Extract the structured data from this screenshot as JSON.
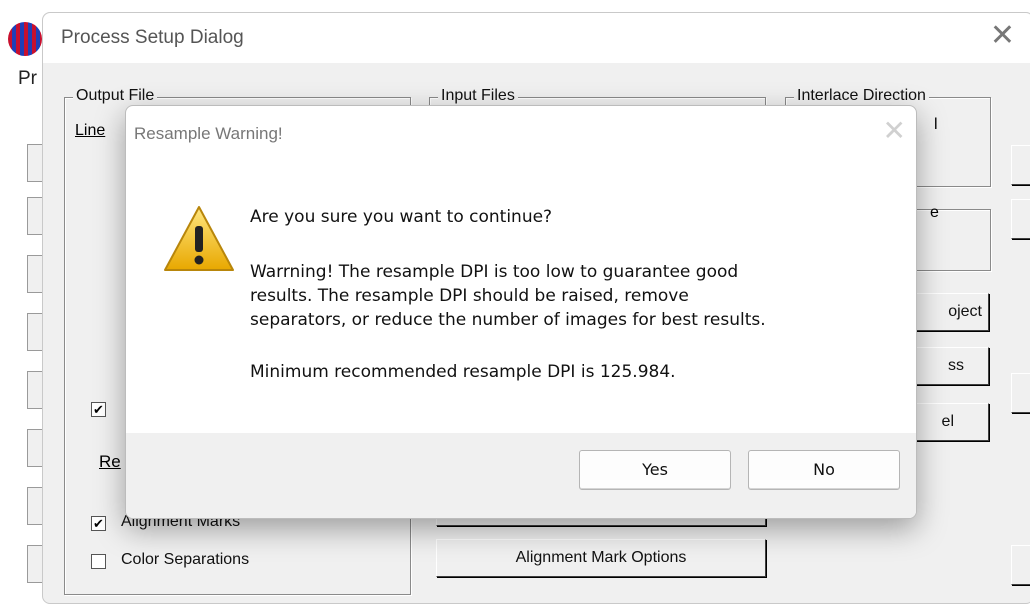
{
  "background": {
    "menu_label": "Pr"
  },
  "main_dialog": {
    "title": "Process Setup Dialog",
    "close_glyph": "✕",
    "output_file": {
      "group_label": "Output File",
      "line_label_visible": "Line",
      "re_label_visible": "Re",
      "alignment_marks": {
        "label": "Alignment Marks",
        "checked": true
      },
      "color_separations": {
        "label": "Color Separations",
        "checked": false
      }
    },
    "input_files": {
      "group_label": "Input Files",
      "alignment_mark_options_button": "Alignment Mark Options"
    },
    "interlace_direction": {
      "group_label": "Interlace Direction",
      "fragment": "l"
    },
    "right_fragments": {
      "e": "e",
      "project": "oject",
      "process": "ss",
      "cancel": "el"
    }
  },
  "warning_dialog": {
    "title": "Resample Warning!",
    "close_glyph": "✕",
    "icon": "warning-triangle-icon",
    "question": "Are you sure you want to continue?",
    "warning_lines": [
      "Warrning!  The resample DPI is too low to guarantee good",
      "results.   The resample DPI should be raised, remove",
      "separators, or reduce the number of images for best results."
    ],
    "minimum_line": "Minimum recommended resample DPI is 125.984.",
    "yes_button": "Yes",
    "no_button": "No"
  },
  "colors": {
    "warning_yellow": "#f2c200",
    "dialog_face": "#f0f0f0"
  }
}
